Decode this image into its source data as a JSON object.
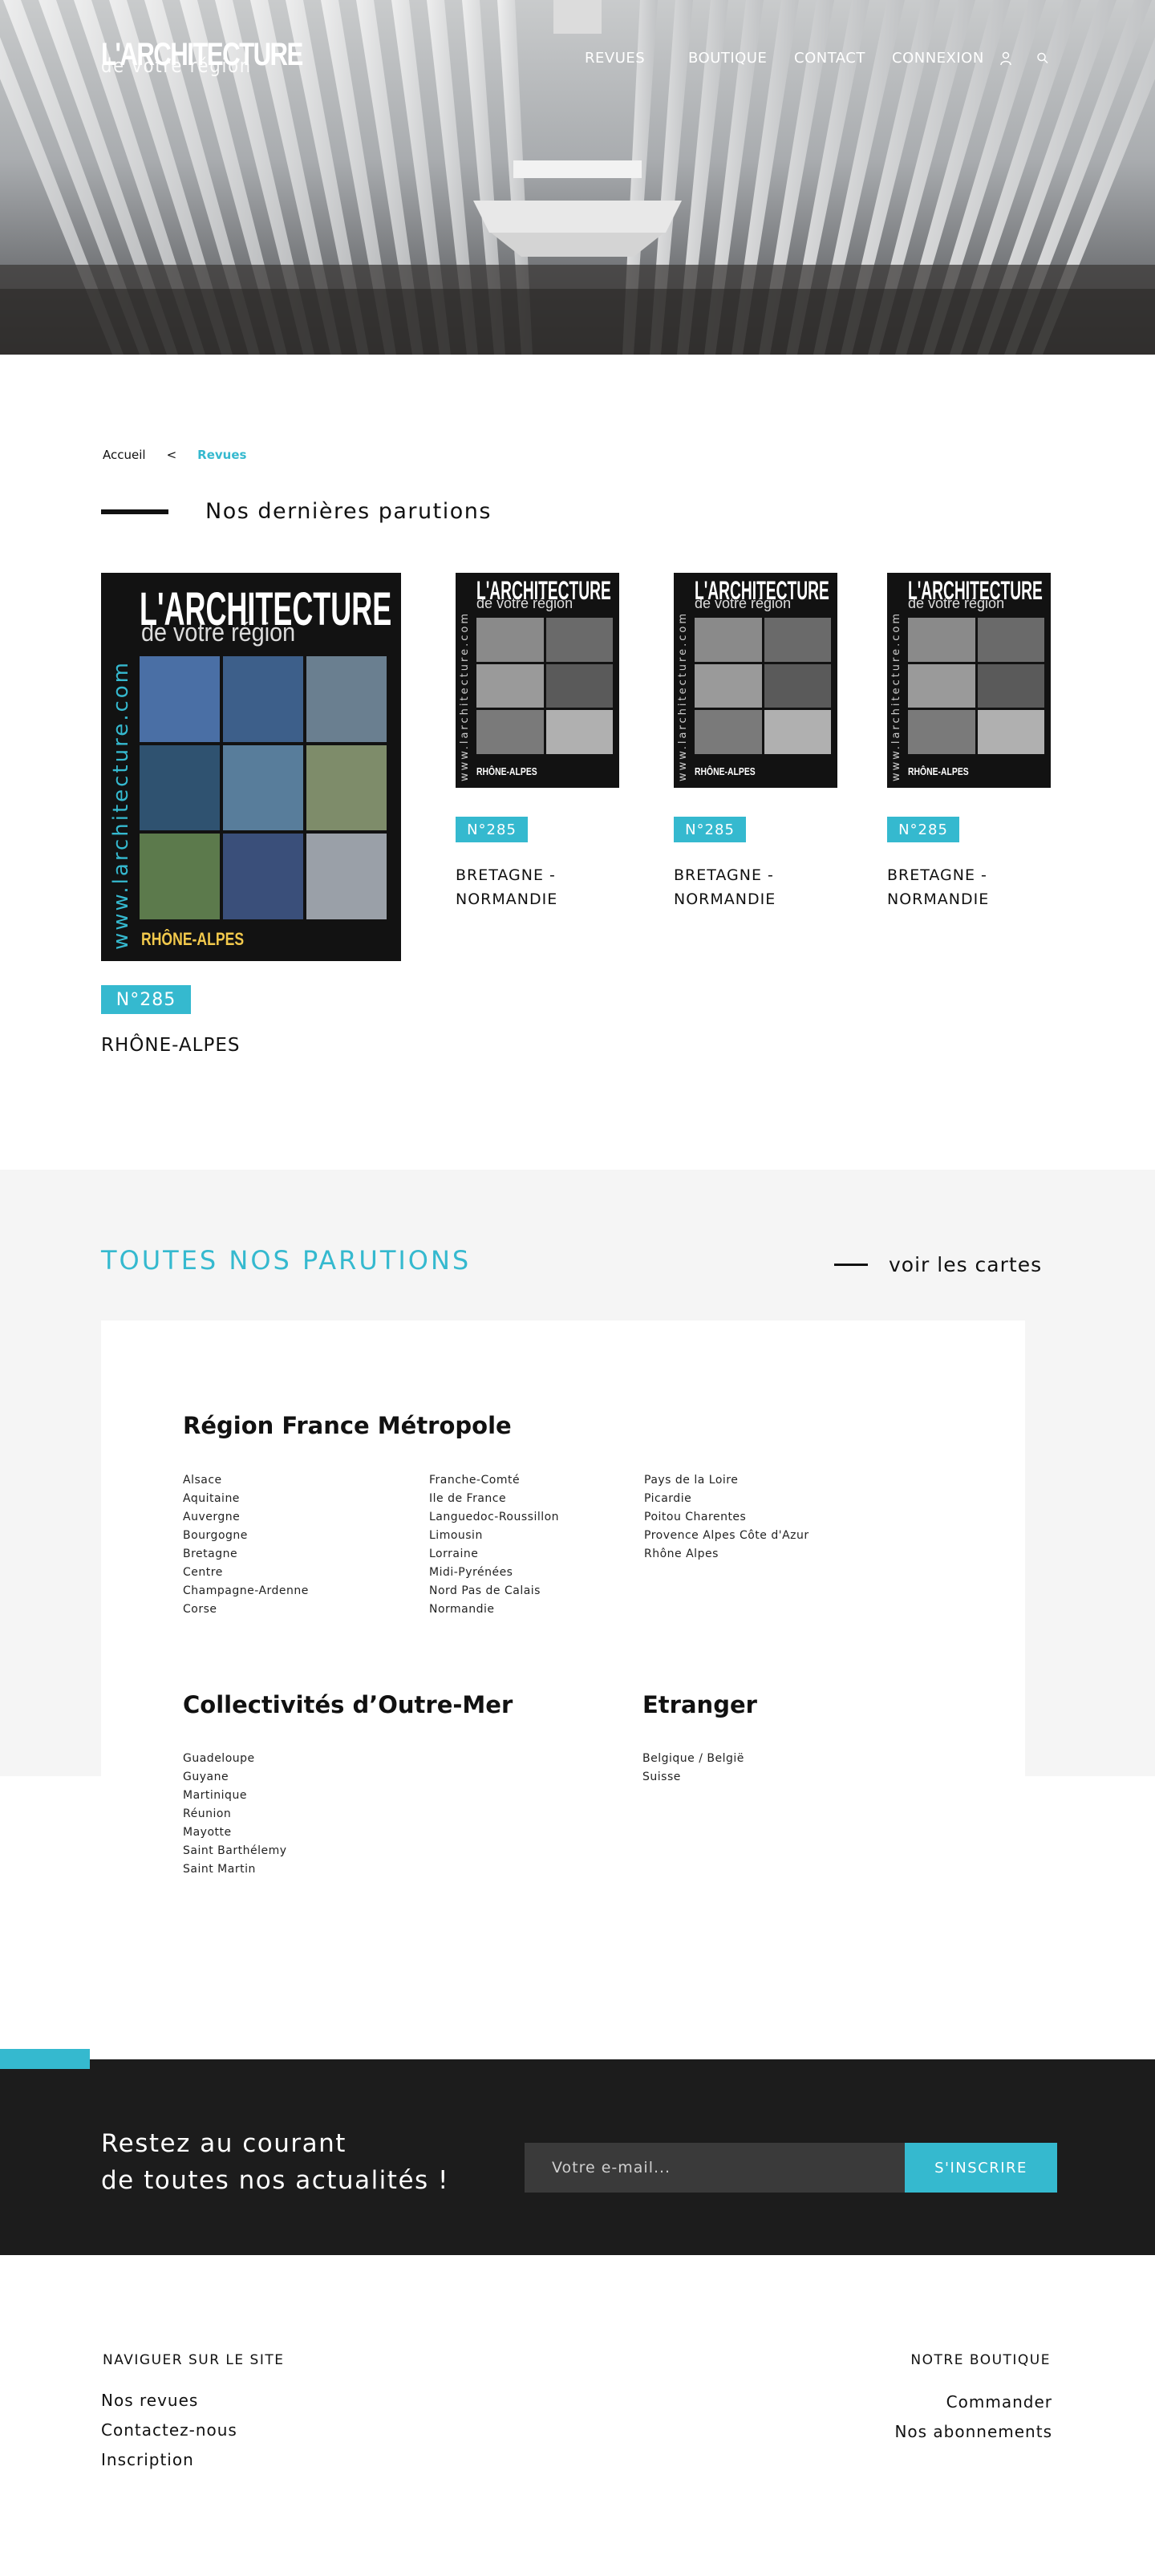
{
  "header": {
    "logo_line1": "L'ARCHITECTURE",
    "logo_line2": "de votre région",
    "nav": [
      "REVUES",
      "BOUTIQUE",
      "CONTACT",
      "CONNEXION"
    ],
    "icons": [
      "user-icon",
      "search-icon"
    ]
  },
  "breadcrumb": {
    "home": "Accueil",
    "separator": "<",
    "current": "Revues"
  },
  "latest": {
    "title": "Nos dernières parutions",
    "featured": {
      "cover_title": "L'ARCHITECTURE",
      "cover_subtitle": "de votre région",
      "cover_url": "www.larchitecture.com",
      "cover_region": "RHÔNE-ALPES",
      "badge": "N°285",
      "name": "RHÔNE-ALPES"
    },
    "others": [
      {
        "badge": "N°285",
        "name_line1": "BRETAGNE -",
        "name_line2": "NORMANDIE",
        "cover_region": "RHÔNE-ALPES"
      },
      {
        "badge": "N°285",
        "name_line1": "BRETAGNE -",
        "name_line2": "NORMANDIE",
        "cover_region": "RHÔNE-ALPES"
      },
      {
        "badge": "N°285",
        "name_line1": "BRETAGNE -",
        "name_line2": "NORMANDIE",
        "cover_region": "RHÔNE-ALPES"
      }
    ]
  },
  "all_issues": {
    "title": "TOUTES NOS PARUTIONS",
    "maps_link": "voir les cartes",
    "metropole": {
      "title": "Région France Métropole",
      "col1": [
        "Alsace",
        "Aquitaine",
        "Auvergne",
        "Bourgogne",
        "Bretagne",
        "Centre",
        "Champagne-Ardenne",
        "Corse"
      ],
      "col2": [
        "Franche-Comté",
        "Ile de France",
        "Languedoc-Roussillon",
        "Limousin",
        "Lorraine",
        "Midi-Pyrénées",
        "Nord Pas de Calais",
        "Normandie"
      ],
      "col3": [
        "Pays de la Loire",
        "Picardie",
        "Poitou Charentes",
        "Provence Alpes Côte d'Azur",
        "Rhône Alpes"
      ]
    },
    "outre_mer": {
      "title": "Collectivités d’Outre-Mer",
      "items": [
        "Guadeloupe",
        "Guyane",
        "Martinique",
        "Réunion",
        "Mayotte",
        "Saint Barthélemy",
        "Saint Martin"
      ]
    },
    "etranger": {
      "title": "Etranger",
      "items": [
        "Belgique / België",
        "Suisse"
      ]
    }
  },
  "newsletter": {
    "line1": "Restez au courant",
    "line2": "de toutes nos actualités !",
    "placeholder": "Votre e-mail...",
    "button": "S'INSCRIRE"
  },
  "footer": {
    "nav_title": "NAVIGUER SUR LE SITE",
    "nav_items": [
      "Nos revues",
      "Contactez-nous",
      "Inscription"
    ],
    "shop_title": "NOTRE BOUTIQUE",
    "shop_items": [
      "Commander",
      "Nos abonnements"
    ]
  },
  "colors": {
    "accent": "#35b9cf",
    "dark": "#1c1c1c",
    "light_bg": "#f5f5f5"
  }
}
